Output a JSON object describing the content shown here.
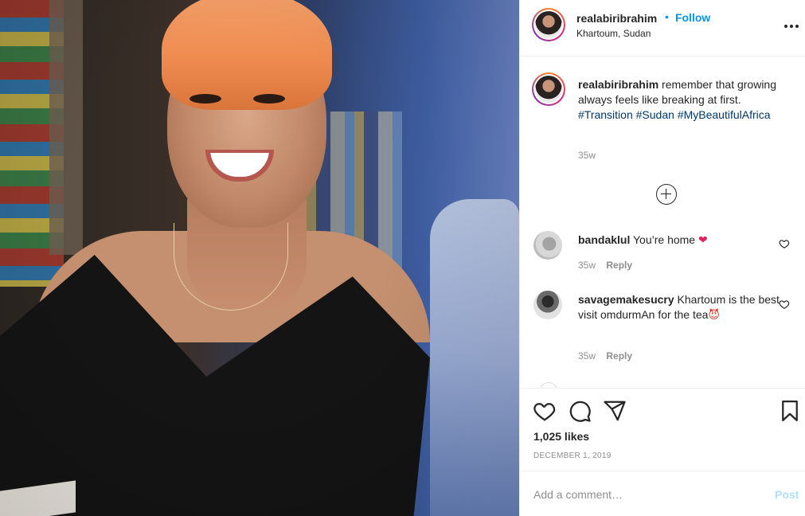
{
  "header": {
    "username": "realabiribrahim",
    "separator": "•",
    "follow_label": "Follow",
    "location": "Khartoum, Sudan",
    "more_icon": "more-options-icon"
  },
  "caption": {
    "username": "realabiribrahim",
    "text": "remember that growing always feels like breaking at first.",
    "hashtags": [
      "#Transition",
      "#Sudan",
      "#MyBeautifulAfrica"
    ],
    "age": "35w"
  },
  "load_more_icon": "plus-circle-icon",
  "comments": [
    {
      "username": "bandaklul",
      "text": "You’re home",
      "emoji": "❤",
      "age": "35w",
      "reply_label": "Reply"
    },
    {
      "username": "savagemakesucry",
      "text": "Khartoum is the best visit omdurmAn for the tea",
      "emoji": "😈",
      "age": "35w",
      "reply_label": "Reply"
    }
  ],
  "actions": {
    "likes": "1,025 likes",
    "date": "DECEMBER 1, 2019"
  },
  "add_comment": {
    "placeholder": "Add a comment…",
    "post_label": "Post"
  },
  "colors": {
    "accent": "#0095f6",
    "hashtag": "#00376b",
    "muted": "#8e8e8e",
    "post_disabled": "#b2dffc",
    "avatar_ring": [
      "#f58529",
      "#dd2a7b",
      "#8134af"
    ]
  }
}
